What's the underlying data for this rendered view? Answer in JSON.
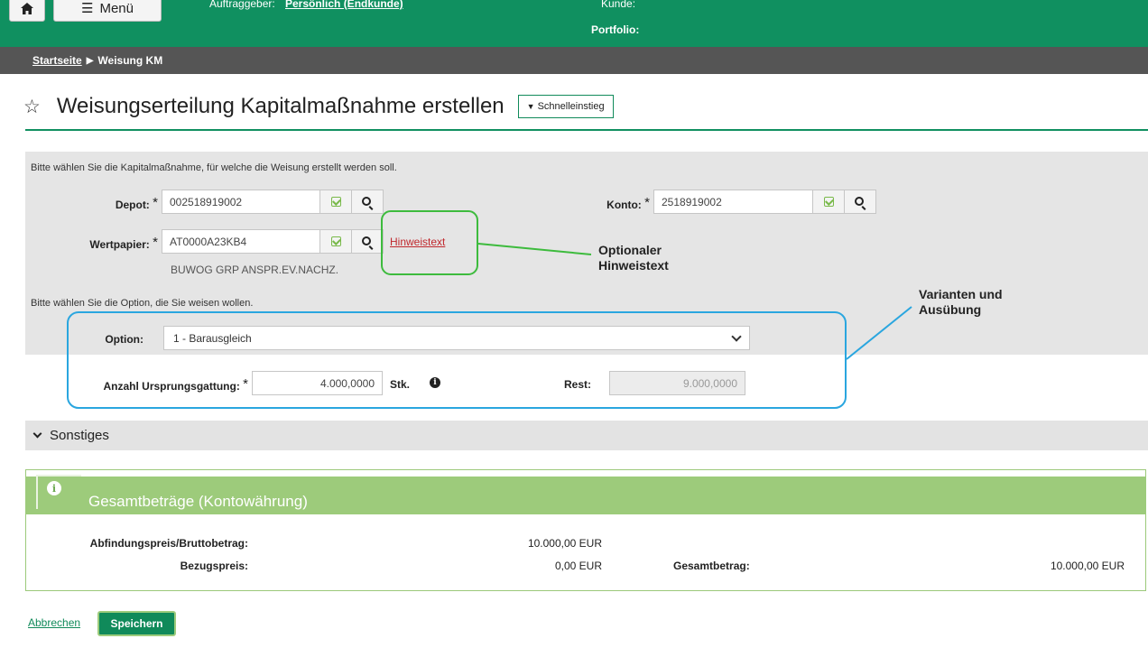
{
  "topbar": {
    "home_icon": "home-icon",
    "menu_label": "Menü",
    "auftraggeber_label": "Auftraggeber:",
    "auftraggeber_value": "Persönlich (Endkunde)",
    "kunde_label": "Kunde:",
    "portfolio_label": "Portfolio:"
  },
  "breadcrumb": {
    "home": "Startseite",
    "current": "Weisung KM"
  },
  "page": {
    "title": "Weisungserteilung Kapitalmaßnahme erstellen",
    "quick_entry": "Schnelleinstieg"
  },
  "form": {
    "intro_1": "Bitte wählen Sie die Kapitalmaßnahme, für welche die Weisung erstellt werden soll.",
    "depot_label": "Depot:",
    "depot_value": "002518919002",
    "konto_label": "Konto:",
    "konto_value": "2518919002",
    "wertpapier_label": "Wertpapier:",
    "wertpapier_value": "AT0000A23KB4",
    "wertpapier_name": "BUWOG GRP ANSPR.EV.NACHZ.",
    "hint_link": "Hinweistext",
    "intro_2": "Bitte wählen Sie die Option, die Sie weisen wollen.",
    "option_label": "Option:",
    "option_value": "1 - Barausgleich",
    "anzahl_label": "Anzahl Ursprungsgattung:",
    "anzahl_value": "4.000,0000",
    "anzahl_unit": "Stk.",
    "rest_label": "Rest:",
    "rest_value": "9.000,0000",
    "required_mark": "*"
  },
  "annotations": {
    "hint_callout_1": "Optionaler",
    "hint_callout_2": "Hinweistext",
    "variant_callout_1": "Varianten und",
    "variant_callout_2": "Ausübung"
  },
  "sonstiges": {
    "label": "Sonstiges"
  },
  "totals": {
    "title": "Gesamtbeträge (Kontowährung)",
    "abfindung_label": "Abfindungspreis/Bruttobetrag:",
    "abfindung_value": "10.000,00 EUR",
    "bezug_label": "Bezugspreis:",
    "bezug_value": "0,00 EUR",
    "gesamt_label": "Gesamtbetrag:",
    "gesamt_value": "10.000,00 EUR"
  },
  "footer": {
    "cancel_label": "Abbrechen",
    "save_label": "Speichern"
  },
  "colors": {
    "brand_green": "#109060",
    "breadcrumb_gray": "#555555",
    "totals_green": "#9dcb7b",
    "annotation_green": "#3dbb3d",
    "annotation_blue": "#2aa6df",
    "hint_red": "#c0282d"
  }
}
